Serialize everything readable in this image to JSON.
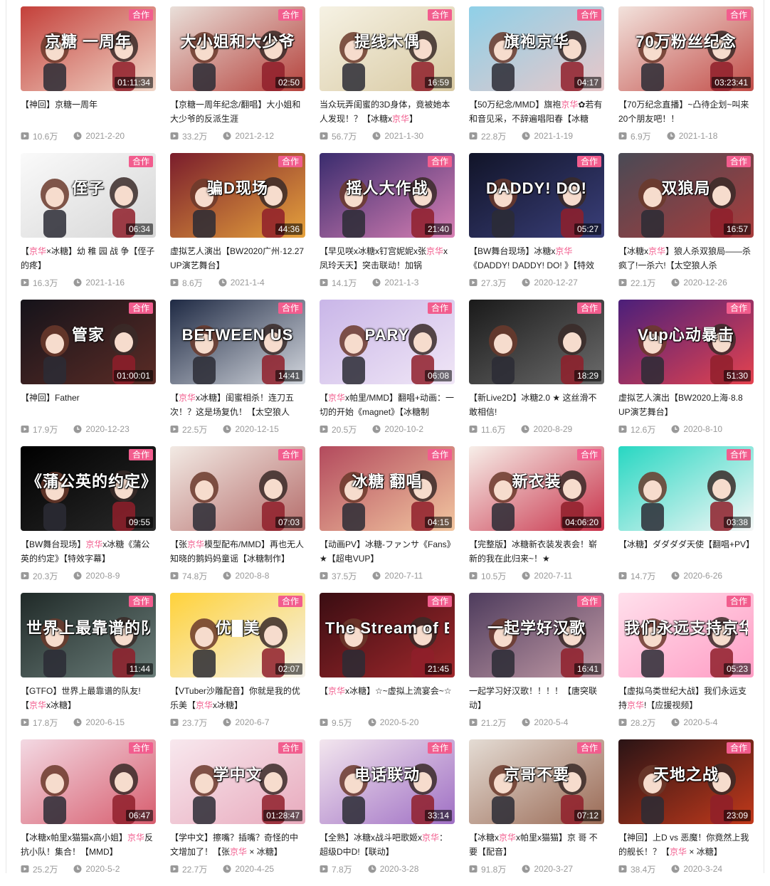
{
  "badge_label": "合作",
  "colors": {
    "accent": "#f25d8e",
    "meta": "#999999",
    "title": "#212121"
  },
  "videos": [
    {
      "title_parts": [
        {
          "t": "【神回】京糖一周年"
        }
      ],
      "duration": "01:11:34",
      "views": "10.6万",
      "date": "2021-2-20",
      "cover": "京糖 一周年",
      "bg": [
        "#c4403a",
        "#f1d6c8"
      ]
    },
    {
      "title_parts": [
        {
          "t": "【京糖一周年纪念/翻唱】大小姐和大少爷的反派生涯"
        }
      ],
      "duration": "02:50",
      "views": "33.2万",
      "date": "2021-2-12",
      "cover": "大小姐和大少爷",
      "bg": [
        "#e9dfd9",
        "#b5423c"
      ]
    },
    {
      "title_parts": [
        {
          "t": "当众玩弄闺蜜的3D身体，竟被她本人发现！？【冰糖x"
        },
        {
          "t": "京华",
          "h": true
        },
        {
          "t": "】"
        }
      ],
      "duration": "16:59",
      "views": "56.7万",
      "date": "2021-1-30",
      "cover": "提线木偶",
      "bg": [
        "#f6f2e4",
        "#d8c9a2"
      ]
    },
    {
      "title_parts": [
        {
          "t": "【50万纪念/MMD】旗袍"
        },
        {
          "t": "京华",
          "h": true
        },
        {
          "t": "✿若有和音见采，不辞遍唱阳春【冰糖"
        }
      ],
      "duration": "04:17",
      "views": "22.8万",
      "date": "2021-1-19",
      "cover": "旗袍京华",
      "bg": [
        "#8fd0e8",
        "#e8c7c9"
      ]
    },
    {
      "title_parts": [
        {
          "t": "【70万纪念直播】~凸待企划~叫来20个朋友吧！！"
        }
      ],
      "duration": "03:23:41",
      "views": "6.9万",
      "date": "2021-1-18",
      "cover": "70万粉丝纪念",
      "bg": [
        "#f2e2dc",
        "#c24d48"
      ]
    },
    {
      "title_parts": [
        {
          "t": "【"
        },
        {
          "t": "京华",
          "h": true
        },
        {
          "t": "×冰糖】幼 稚 园 战 争【侄子的疼】"
        }
      ],
      "duration": "06:34",
      "views": "16.3万",
      "date": "2021-1-16",
      "cover": "侄子",
      "bg": [
        "#fafafa",
        "#d6d6d6"
      ]
    },
    {
      "title_parts": [
        {
          "t": "虚拟艺人演出【BW2020广州·12.27 UP演艺舞台】"
        }
      ],
      "duration": "44:36",
      "views": "8.6万",
      "date": "2021-1-4",
      "cover": "骗D现场",
      "bg": [
        "#7a1d2c",
        "#e6a23c"
      ]
    },
    {
      "title_parts": [
        {
          "t": "【早见咲x冰糖x钉宫妮妮x张"
        },
        {
          "t": "京华",
          "h": true
        },
        {
          "t": "x凤玲天天】突击联动！加锅"
        }
      ],
      "duration": "21:40",
      "views": "14.1万",
      "date": "2021-1-3",
      "cover": "摇人大作战",
      "bg": [
        "#3a2c6e",
        "#d77fb3"
      ]
    },
    {
      "title_parts": [
        {
          "t": "【BW舞台现场】冰糖x"
        },
        {
          "t": "京华",
          "h": true
        },
        {
          "t": "《DADDY! DADDY! DO! 》【特效"
        }
      ],
      "duration": "05:27",
      "views": "27.3万",
      "date": "2020-12-27",
      "cover": "DADDY! DO!",
      "bg": [
        "#111428",
        "#3a3f7a"
      ]
    },
    {
      "title_parts": [
        {
          "t": "【冰糖x"
        },
        {
          "t": "京华",
          "h": true
        },
        {
          "t": "】狼人杀双狼局——杀疯了!一杀六!【太空狼人杀"
        }
      ],
      "duration": "16:57",
      "views": "22.1万",
      "date": "2020-12-26",
      "cover": "双狼局",
      "bg": [
        "#4a4a55",
        "#a83c3c"
      ]
    },
    {
      "title_parts": [
        {
          "t": "【神回】Father"
        }
      ],
      "duration": "01:00:01",
      "views": "17.9万",
      "date": "2020-12-23",
      "cover": "管家",
      "bg": [
        "#15131a",
        "#5b2c26"
      ]
    },
    {
      "title_parts": [
        {
          "t": "【"
        },
        {
          "t": "京华",
          "h": true
        },
        {
          "t": "x冰糖】闺蜜相杀！连刀五次！？这是场复仇！【太空狼人"
        }
      ],
      "duration": "14:41",
      "views": "22.5万",
      "date": "2020-12-15",
      "cover": "BETWEEN US",
      "bg": [
        "#1f2a44",
        "#d3d7de"
      ]
    },
    {
      "title_parts": [
        {
          "t": "【"
        },
        {
          "t": "京华",
          "h": true
        },
        {
          "t": "x帕里/MMD】翻唱+动画：一切的开始《magnet》【冰糖制"
        }
      ],
      "duration": "06:08",
      "views": "20.5万",
      "date": "2020-10-2",
      "cover": "PARY",
      "bg": [
        "#c9b6e8",
        "#f0e6f6"
      ]
    },
    {
      "title_parts": [
        {
          "t": "【新Live2D】冰糖2.0 ★ 这丝滑不敢相信!"
        }
      ],
      "duration": "18:29",
      "views": "11.6万",
      "date": "2020-8-29",
      "cover": "",
      "bg": [
        "#1a1a1a",
        "#6b6b6b"
      ]
    },
    {
      "title_parts": [
        {
          "t": "虚拟艺人演出【BW2020上海·8.8 UP演艺舞台】"
        }
      ],
      "duration": "51:30",
      "views": "12.6万",
      "date": "2020-8-10",
      "cover": "Vup心动暴击",
      "bg": [
        "#4b1f7a",
        "#e5434f"
      ]
    },
    {
      "title_parts": [
        {
          "t": "【BW舞台现场】"
        },
        {
          "t": "京华",
          "h": true
        },
        {
          "t": "x冰糖《蒲公英的约定》【特效字幕】"
        }
      ],
      "duration": "09:55",
      "views": "20.3万",
      "date": "2020-8-9",
      "cover": "《蒲公英的约定》",
      "bg": [
        "#000000",
        "#2a2a2a"
      ]
    },
    {
      "title_parts": [
        {
          "t": "【张"
        },
        {
          "t": "京华",
          "h": true
        },
        {
          "t": "模型配布/MMD】再也无人知晓的鹅妈妈童谣【冰糖制作】"
        }
      ],
      "duration": "07:03",
      "views": "74.8万",
      "date": "2020-8-8",
      "cover": "",
      "bg": [
        "#f2eae4",
        "#b56d6b"
      ]
    },
    {
      "title_parts": [
        {
          "t": "【动画PV】冰糖-ファンサ《Fans》★【超电VUP】"
        }
      ],
      "duration": "04:15",
      "views": "37.5万",
      "date": "2020-7-11",
      "cover": "冰糖 翻唱",
      "bg": [
        "#b34a5d",
        "#f2c6a0"
      ]
    },
    {
      "title_parts": [
        {
          "t": "【完整版】冰糖新衣装发表会！崭新的我在此归来~！★"
        }
      ],
      "duration": "04:06:20",
      "views": "10.5万",
      "date": "2020-7-11",
      "cover": "新衣装",
      "bg": [
        "#f7efe9",
        "#c8324a"
      ]
    },
    {
      "title_parts": [
        {
          "t": "【冰糖】ダダダダ天使【翻唱+PV】"
        }
      ],
      "duration": "03:38",
      "views": "14.7万",
      "date": "2020-6-26",
      "cover": "",
      "bg": [
        "#27d7c2",
        "#f7f7f7"
      ]
    },
    {
      "title_parts": [
        {
          "t": "【GTFO】世界上最靠谱的队友!【"
        },
        {
          "t": "京华",
          "h": true
        },
        {
          "t": "x冰糖】"
        }
      ],
      "duration": "11:44",
      "views": "17.8万",
      "date": "2020-6-15",
      "cover": "世界上最靠谱的队友",
      "bg": [
        "#202a28",
        "#6b7e7a"
      ]
    },
    {
      "title_parts": [
        {
          "t": "【VTuber沙雕配音】你就是我的优乐美【"
        },
        {
          "t": "京华",
          "h": true
        },
        {
          "t": "x冰糖】"
        }
      ],
      "duration": "02:07",
      "views": "23.7万",
      "date": "2020-6-7",
      "cover": "优█美",
      "bg": [
        "#ffd23a",
        "#f4f1ea"
      ]
    },
    {
      "title_parts": [
        {
          "t": "【"
        },
        {
          "t": "京华",
          "h": true
        },
        {
          "t": "x冰糖】☆~虚拟上流宴会~☆"
        }
      ],
      "duration": "21:45",
      "views": "9.5万",
      "date": "2020-5-20",
      "cover": "The Stream of Eleg",
      "bg": [
        "#3a0d12",
        "#a0282c"
      ]
    },
    {
      "title_parts": [
        {
          "t": "一起学习好汉歌！！！！【唐突联动】"
        }
      ],
      "duration": "16:41",
      "views": "21.2万",
      "date": "2020-5-4",
      "cover": "一起学好汉歌",
      "bg": [
        "#4e3c5d",
        "#c29aa6"
      ]
    },
    {
      "title_parts": [
        {
          "t": "【虚拟乌类世纪大战】我们永远支持"
        },
        {
          "t": "京华",
          "h": true
        },
        {
          "t": "!【应援视频】"
        }
      ],
      "duration": "05:23",
      "views": "28.2万",
      "date": "2020-5-4",
      "cover": "我们永远支持京华!",
      "bg": [
        "#ffe0ec",
        "#ff9cc4"
      ]
    },
    {
      "title_parts": [
        {
          "t": "【冰糖x帕里x猫猫x高小姐】"
        },
        {
          "t": "京华",
          "h": true
        },
        {
          "t": "反抗小队！集合！【MMD】"
        }
      ],
      "duration": "06:47",
      "views": "25.2万",
      "date": "2020-5-2",
      "cover": "",
      "bg": [
        "#f3d9e3",
        "#d75d6e"
      ]
    },
    {
      "title_parts": [
        {
          "t": "【学中文】擦嘴？插嘴？奇怪的中文增加了！【张"
        },
        {
          "t": "京华",
          "h": true
        },
        {
          "t": " × 冰糖】"
        }
      ],
      "duration": "01:28:47",
      "views": "22.7万",
      "date": "2020-4-25",
      "cover": "学中文",
      "bg": [
        "#f8e8ee",
        "#e8aabd"
      ]
    },
    {
      "title_parts": [
        {
          "t": "【全熟】冰糖x战斗吧歌姬x"
        },
        {
          "t": "京华",
          "h": true
        },
        {
          "t": "：超级D中D!【联动】"
        }
      ],
      "duration": "33:14",
      "views": "7.8万",
      "date": "2020-3-28",
      "cover": "电话联动",
      "bg": [
        "#f3e6ee",
        "#9f6fc4"
      ]
    },
    {
      "title_parts": [
        {
          "t": "【冰糖x"
        },
        {
          "t": "京华",
          "h": true
        },
        {
          "t": "x帕里x猫猫】京 哥 不要【配音】"
        }
      ],
      "duration": "07:12",
      "views": "91.8万",
      "date": "2020-3-27",
      "cover": "京哥不要",
      "bg": [
        "#e4dcd4",
        "#9a6a55"
      ]
    },
    {
      "title_parts": [
        {
          "t": "【神回】上D vs 恶魔！你竟然上我的舰长！？【"
        },
        {
          "t": "京华",
          "h": true
        },
        {
          "t": " × 冰糖】"
        }
      ],
      "duration": "23:09",
      "views": "38.4万",
      "date": "2020-3-24",
      "cover": "天地之战",
      "bg": [
        "#2a1416",
        "#c2391b"
      ]
    }
  ]
}
